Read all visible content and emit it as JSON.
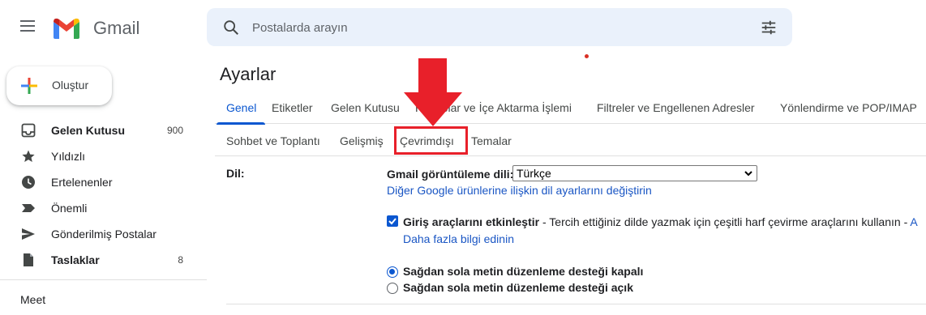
{
  "header": {
    "brand": "Gmail",
    "search_placeholder": "Postalarda arayın"
  },
  "sidebar": {
    "compose_label": "Oluştur",
    "items": [
      {
        "label": "Gelen Kutusu",
        "count": "900",
        "bold": true,
        "icon": "inbox-icon"
      },
      {
        "label": "Yıldızlı",
        "count": "",
        "bold": false,
        "icon": "star-icon"
      },
      {
        "label": "Ertelenenler",
        "count": "",
        "bold": false,
        "icon": "clock-icon"
      },
      {
        "label": "Önemli",
        "count": "",
        "bold": false,
        "icon": "important-icon"
      },
      {
        "label": "Gönderilmiş Postalar",
        "count": "",
        "bold": false,
        "icon": "send-icon"
      },
      {
        "label": "Taslaklar",
        "count": "8",
        "bold": true,
        "icon": "draft-icon"
      }
    ],
    "meet_label": "Meet"
  },
  "settings": {
    "title": "Ayarlar",
    "tabs_row1": [
      "Genel",
      "Etiketler",
      "Gelen Kutusu",
      "Hesaplar ve İçe Aktarma İşlemi",
      "Filtreler ve Engellenen Adresler",
      "Yönlendirme ve POP/IMAP"
    ],
    "tabs_row2": [
      "Sohbet ve Toplantı",
      "Gelişmiş",
      "Çevrimdışı",
      "Temalar"
    ],
    "language": {
      "row_label": "Dil:",
      "display_label": "Gmail görüntüleme dili:",
      "selected": "Türkçe",
      "other_settings_link": "Diğer Google ürünlerine ilişkin dil ayarlarını değiştirin"
    },
    "input_tools": {
      "label": "Giriş araçlarını etkinleştir",
      "description": " - Tercih ettiğiniz dilde yazmak için çeşitli harf çevirme araçlarını kullanın - ",
      "trailing": "A",
      "learn_more": "Daha fazla bilgi edinin",
      "checked": true
    },
    "rtl": {
      "off_label": "Sağdan sola metin düzenleme desteği kapalı",
      "on_label": "Sağdan sola metin düzenleme desteği açık",
      "selected": "off"
    }
  },
  "colors": {
    "accent": "#0b57d0",
    "highlight": "#e8202a"
  }
}
